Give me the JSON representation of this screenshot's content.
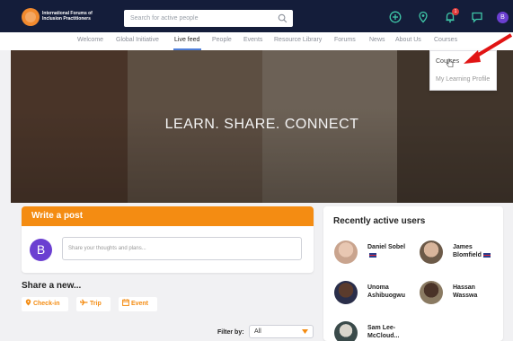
{
  "header": {
    "logo_lines": [
      "International Forums of",
      "Inclusion Practitioners"
    ],
    "search_placeholder": "Search for active people",
    "notification_count": "1",
    "user_initial": "B"
  },
  "nav": {
    "items": [
      "Welcome",
      "Global Initiative",
      "Live feed",
      "People",
      "Events",
      "Resource Library",
      "Forums",
      "News",
      "About Us",
      "Courses"
    ],
    "active": "Live feed"
  },
  "courses_menu": {
    "items": [
      "Courses",
      "My Learning Profile"
    ]
  },
  "hero": {
    "tagline": "LEARN. SHARE. CONNECT"
  },
  "post": {
    "header": "Write a post",
    "avatar_initial": "B",
    "placeholder": "Share your thoughts and plans..."
  },
  "share": {
    "title": "Share a new...",
    "options": [
      "Check-in",
      "Trip",
      "Event"
    ]
  },
  "filter": {
    "label": "Filter by:",
    "value": "All"
  },
  "recent_users": {
    "title": "Recently active users",
    "users": [
      {
        "name_line1": "Daniel Sobel",
        "name_line2": ""
      },
      {
        "name_line1": "James",
        "name_line2": "Blomfield"
      },
      {
        "name_line1": "Unoma",
        "name_line2": "Ashibuogwu"
      },
      {
        "name_line1": "Hassan",
        "name_line2": "Wasswa"
      },
      {
        "name_line1": "Sam Lee-",
        "name_line2": "McCloud..."
      }
    ]
  },
  "colors": {
    "topbar": "#141d3a",
    "accent_orange": "#f48c12",
    "accent_purple": "#6b3fd1",
    "nav_active_underline": "#4f7fd9",
    "annotation_arrow": "#e11414"
  }
}
